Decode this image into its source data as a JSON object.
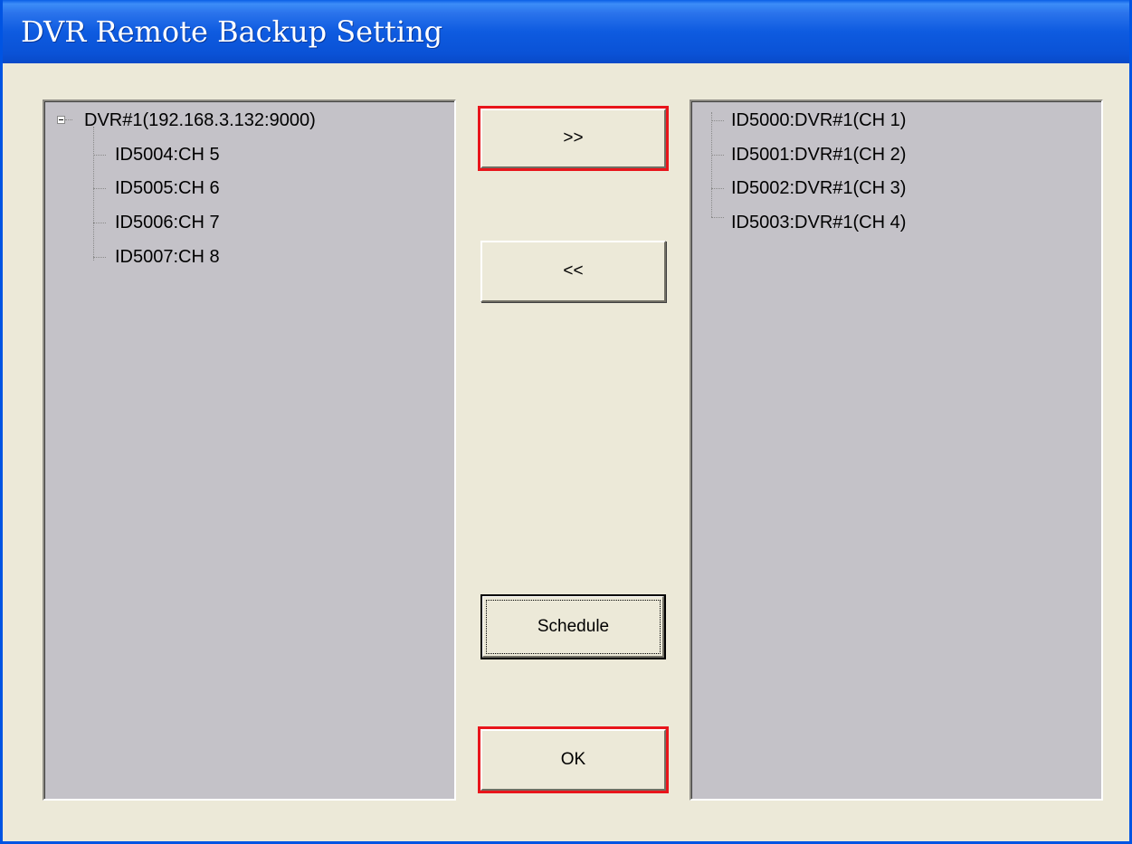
{
  "window": {
    "title": "DVR Remote Backup Setting"
  },
  "available_tree": {
    "root": "DVR#1(192.168.3.132:9000)",
    "children": [
      "ID5004:CH 5",
      "ID5005:CH 6",
      "ID5006:CH 7",
      "ID5007:CH 8"
    ]
  },
  "selected_tree": {
    "items": [
      "ID5000:DVR#1(CH 1)",
      "ID5001:DVR#1(CH 2)",
      "ID5002:DVR#1(CH 3)",
      "ID5003:DVR#1(CH 4)"
    ]
  },
  "buttons": {
    "add": ">>",
    "remove": "<<",
    "schedule": "Schedule",
    "ok": "OK"
  },
  "colors": {
    "highlight": "#E8151B",
    "titlebar": "#0A52D6"
  }
}
